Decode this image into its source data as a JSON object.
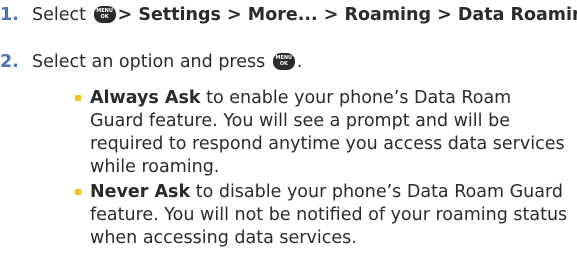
{
  "steps": [
    {
      "number": "1.",
      "prefix": "Select",
      "path": "> Settings > More... > Roaming > Data Roaming",
      "suffix": "."
    },
    {
      "number": "2.",
      "prefix": "Select an option and press",
      "suffix": "."
    }
  ],
  "menu_key": {
    "top": "MENU",
    "bottom": "OK"
  },
  "options": [
    {
      "title": "Always Ask",
      "description": "to enable your phone’s Data Roam Guard feature. You will see a prompt and will be required to respond anytime you access data services while roaming."
    },
    {
      "title": "Never Ask",
      "description": "to disable your phone’s Data Roam Guard feature. You will not be notified of your roaming status when accessing data services."
    }
  ],
  "colors": {
    "step_number": "#4a73b8",
    "bullet": "#f2c51a",
    "text": "#2b2b2b"
  }
}
